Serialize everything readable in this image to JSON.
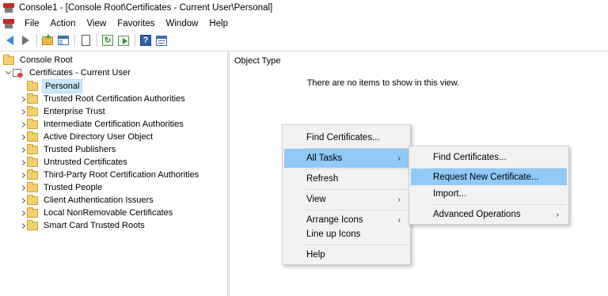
{
  "window": {
    "title": "Console1 - [Console Root\\Certificates - Current User\\Personal]"
  },
  "menu": {
    "items": [
      "File",
      "Action",
      "View",
      "Favorites",
      "Window",
      "Help"
    ]
  },
  "toolbar": {
    "icons": [
      "back-arrow-icon",
      "forward-arrow-icon",
      "up-one-level-icon",
      "show-hide-console-tree-icon",
      "properties-doc-icon",
      "refresh-icon",
      "export-list-icon",
      "help-icon",
      "show-hide-action-pane-icon"
    ]
  },
  "tree": {
    "root": "Console Root",
    "store": "Certificates - Current User",
    "selected": "Personal",
    "folders": [
      "Trusted Root Certification Authorities",
      "Enterprise Trust",
      "Intermediate Certification Authorities",
      "Active Directory User Object",
      "Trusted Publishers",
      "Untrusted Certificates",
      "Third-Party Root Certification Authorities",
      "Trusted People",
      "Client Authentication Issuers",
      "Local NonRemovable Certificates",
      "Smart Card Trusted Roots"
    ]
  },
  "list": {
    "column": "Object Type",
    "empty_message": "There are no items to show in this view."
  },
  "context_menu": {
    "items": [
      "Find Certificates...",
      "All Tasks",
      "Refresh",
      "View",
      "Arrange Icons",
      "Line up Icons",
      "Help"
    ],
    "highlighted": "All Tasks",
    "submenu_arrow": "›"
  },
  "submenu": {
    "items": [
      "Find Certificates...",
      "Request New Certificate...",
      "Import...",
      "Advanced Operations"
    ],
    "highlighted": "Request New Certificate...",
    "submenu_arrow": "›"
  },
  "colors": {
    "menu_highlight": "#91c9f7",
    "tree_selection": "#cce8ff",
    "menu_background": "#f2f2f2"
  }
}
